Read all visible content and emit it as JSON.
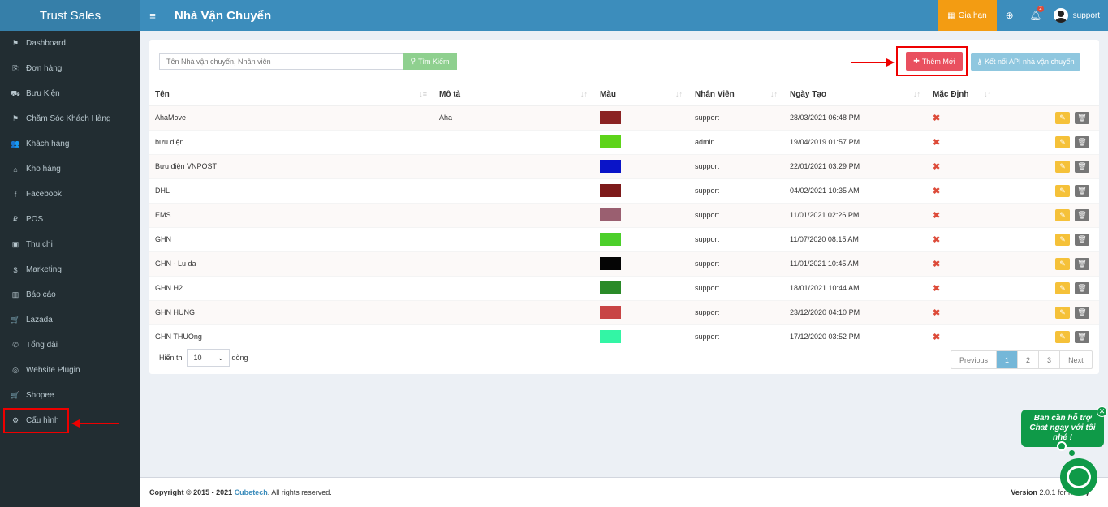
{
  "brand": "Trust Sales",
  "header": {
    "title": "Nhà Vận Chuyển",
    "renew_label": "Gia hạn",
    "notif_count": "2",
    "username": "support"
  },
  "sidebar": {
    "items": [
      {
        "label": "Dashboard",
        "icon": "⚑"
      },
      {
        "label": "Đơn hàng",
        "icon": "⎘"
      },
      {
        "label": "Bưu Kiện",
        "icon": "⛟"
      },
      {
        "label": "Chăm Sóc Khách Hàng",
        "icon": "⚑"
      },
      {
        "label": "Khách hàng",
        "icon": "👥"
      },
      {
        "label": "Kho hàng",
        "icon": "⌂"
      },
      {
        "label": "Facebook",
        "icon": "f"
      },
      {
        "label": "POS",
        "icon": "₽"
      },
      {
        "label": "Thu chi",
        "icon": "▣"
      },
      {
        "label": "Marketing",
        "icon": "$"
      },
      {
        "label": "Báo cáo",
        "icon": "▥"
      },
      {
        "label": "Lazada",
        "icon": "🛒"
      },
      {
        "label": "Tổng đài",
        "icon": "✆"
      },
      {
        "label": "Website Plugin",
        "icon": "◎"
      },
      {
        "label": "Shopee",
        "icon": "🛒"
      },
      {
        "label": "Cấu hình",
        "icon": "⚙"
      }
    ]
  },
  "toolbar": {
    "search_placeholder": "Tên Nhà vận chuyển, Nhân viên",
    "search_label": "Tìm Kiếm",
    "add_label": "Thêm Mới",
    "api_label": "Kết nối API nhà vận chuyển"
  },
  "table": {
    "headers": [
      "Tên",
      "Mô tả",
      "Màu",
      "Nhân Viên",
      "Ngày Tạo",
      "Mặc Định"
    ],
    "rows": [
      {
        "name": "AhaMove",
        "desc": "Aha",
        "color": "#8b2323",
        "staff": "support",
        "date": "28/03/2021 06:48 PM"
      },
      {
        "name": "bưu điện",
        "desc": "",
        "color": "#5ed41a",
        "staff": "admin",
        "date": "19/04/2019 01:57 PM"
      },
      {
        "name": "Bưu điện VNPOST",
        "desc": "",
        "color": "#0a14c8",
        "staff": "support",
        "date": "22/01/2021 03:29 PM"
      },
      {
        "name": "DHL",
        "desc": "",
        "color": "#7d1a1a",
        "staff": "support",
        "date": "04/02/2021 10:35 AM"
      },
      {
        "name": "EMS",
        "desc": "",
        "color": "#9a5f70",
        "staff": "support",
        "date": "11/01/2021 02:26 PM"
      },
      {
        "name": "GHN",
        "desc": "",
        "color": "#4ccf2a",
        "staff": "support",
        "date": "11/07/2020 08:15 AM"
      },
      {
        "name": "GHN - Lu da",
        "desc": "",
        "color": "#050505",
        "staff": "support",
        "date": "11/01/2021 10:45 AM"
      },
      {
        "name": "GHN H2",
        "desc": "",
        "color": "#2a8a28",
        "staff": "support",
        "date": "18/01/2021 10:44 AM"
      },
      {
        "name": "GHN HUNG",
        "desc": "",
        "color": "#c84444",
        "staff": "support",
        "date": "23/12/2020 04:10 PM"
      },
      {
        "name": "GHN THUOng",
        "desc": "",
        "color": "#33f5a5",
        "staff": "support",
        "date": "17/12/2020 03:52 PM"
      }
    ]
  },
  "length": {
    "prefix": "Hiển thị",
    "value": "10",
    "suffix": "dòng"
  },
  "pagination": [
    "Previous",
    "1",
    "2",
    "3",
    "Next"
  ],
  "footer": {
    "copyright": "Copyright © 2015 - 2021",
    "company": "Cubetech",
    "rights": ". All rights reserved.",
    "version_label": "Version",
    "version": "2.0.1 for ho",
    "version_tail": "ndy"
  },
  "chat": {
    "message": "Ban cần hỗ trợ Chat ngay với tôi nhé !"
  }
}
